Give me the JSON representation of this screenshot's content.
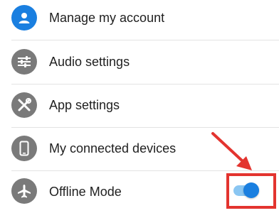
{
  "colors": {
    "account_icon_bg": "#1a7fe0",
    "icon_bg": "#7a7a7a",
    "toggle_on": "#1a7fe0",
    "toggle_track": "#8ac6f2",
    "highlight": "#e3342f"
  },
  "menu": {
    "items": [
      {
        "label": "Manage my account",
        "icon": "person-icon"
      },
      {
        "label": "Audio settings",
        "icon": "sliders-icon"
      },
      {
        "label": "App settings",
        "icon": "tools-icon"
      },
      {
        "label": "My connected devices",
        "icon": "phone-icon"
      },
      {
        "label": "Offline Mode",
        "icon": "airplane-icon"
      }
    ]
  },
  "offline_mode": {
    "toggle_state": "on"
  }
}
